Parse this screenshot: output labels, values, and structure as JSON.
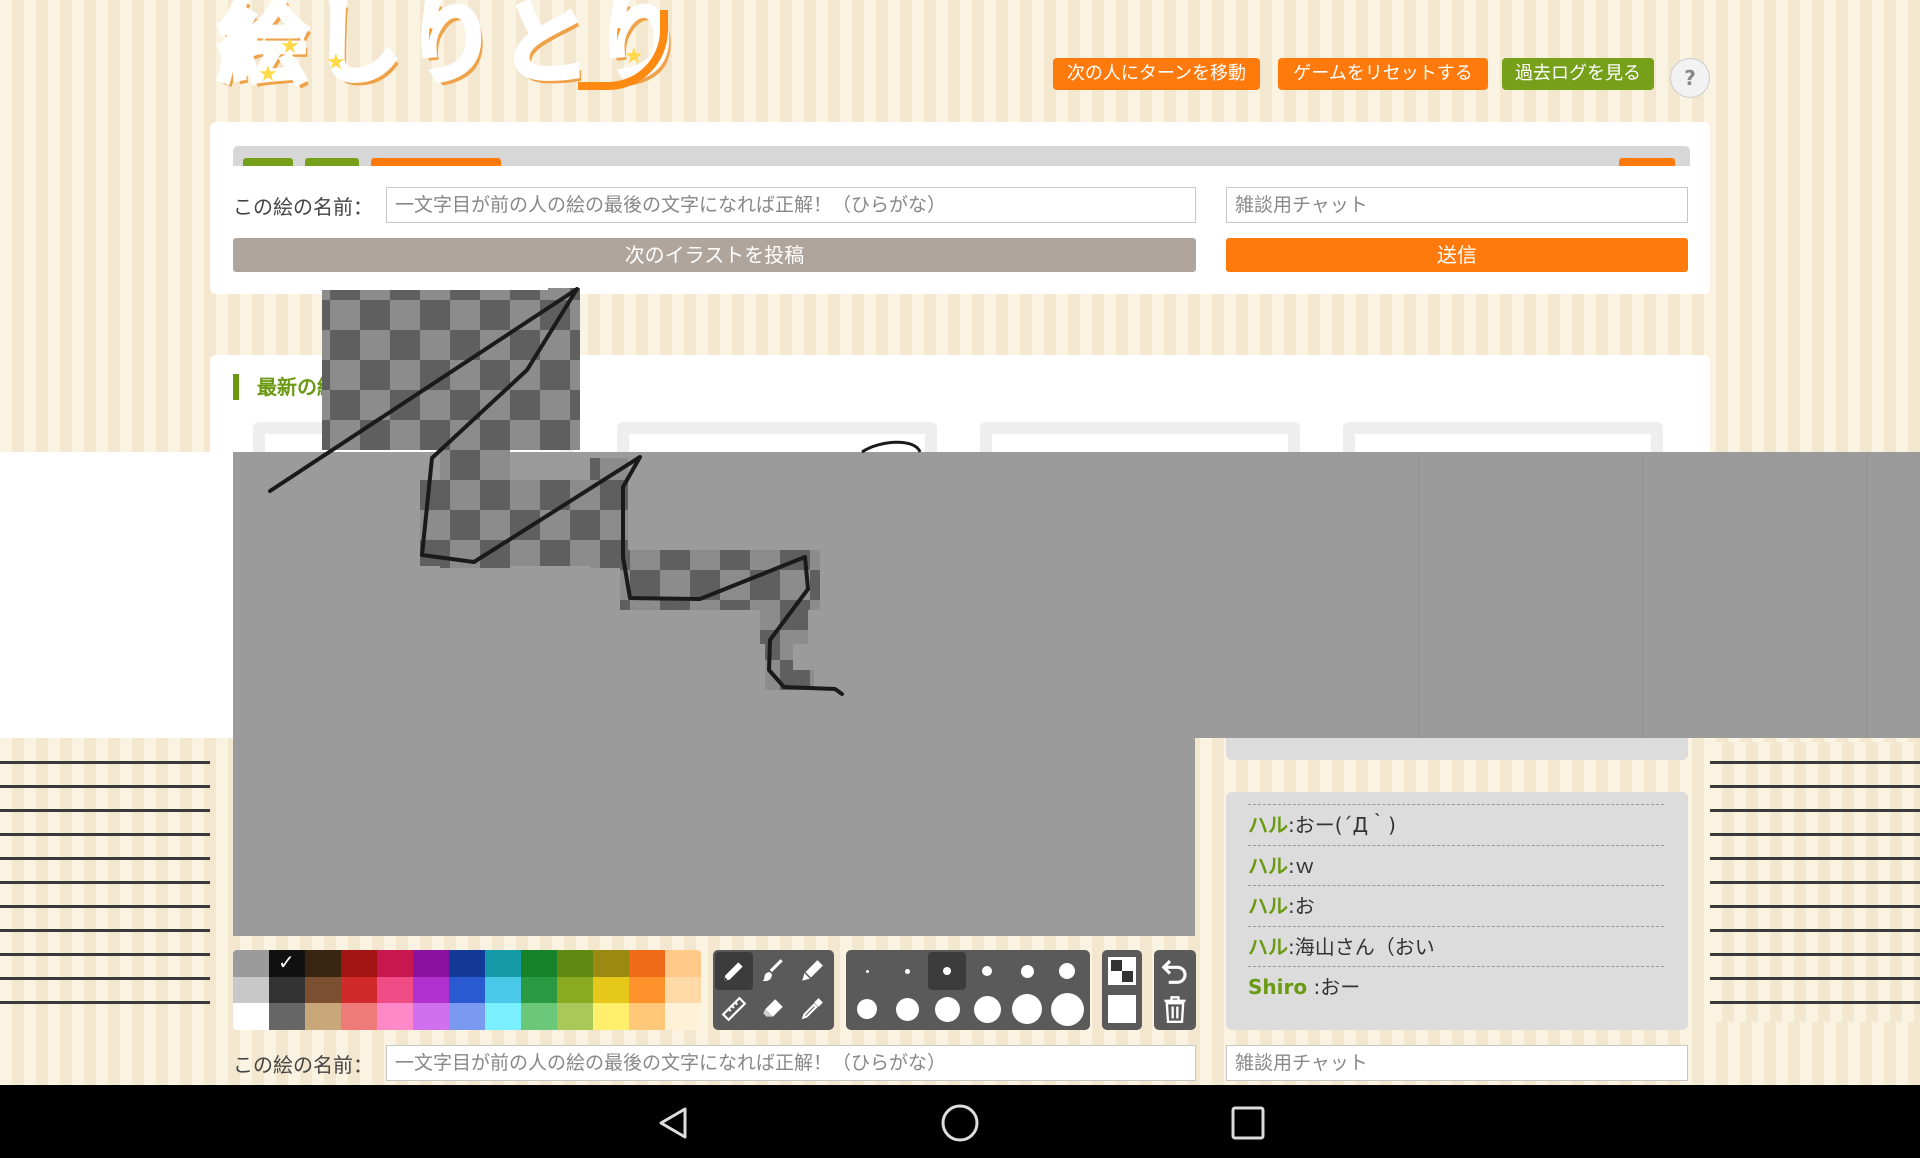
{
  "header": {
    "logo_text": "絵しりとり",
    "buttons": {
      "next_turn": "次の人にターンを移動",
      "reset": "ゲームをリセットする",
      "past_log": "過去ログを見る",
      "help": "?"
    }
  },
  "top_form": {
    "name_label": "この絵の名前：",
    "name_placeholder": "一文字目が前の人の絵の最後の文字になれば正解！（ひらがな）",
    "chat_placeholder": "雑談用チャット",
    "post_button": "次のイラストを投稿",
    "send_button": "送信"
  },
  "latest": {
    "heading": "最新の絵"
  },
  "colors": {
    "accent_orange": "#ff7a0d",
    "accent_green": "#76a01a",
    "post_button": "#b0a59c",
    "canvas": "#9b9b9b",
    "tool_box": "#5a5a5a",
    "palette": [
      "#9b9b9b",
      "#111111",
      "#3a2512",
      "#a31515",
      "#c8174e",
      "#8a12a0",
      "#133a96",
      "#159aa8",
      "#17822a",
      "#5e8a12",
      "#9a8a12",
      "#f06a18",
      "#ffc98a",
      "#c8c8c8",
      "#333333",
      "#7a5030",
      "#d02a2a",
      "#ef4c85",
      "#b030d0",
      "#2a5ad0",
      "#4ac8e8",
      "#2a9a42",
      "#8aaa22",
      "#e6c81a",
      "#ff922a",
      "#ffd9a6",
      "#ffffff",
      "#666666",
      "#c8a878",
      "#ef7a7a",
      "#ff88c8",
      "#d070ef",
      "#7a9aef",
      "#7aefff",
      "#6ac878",
      "#aac85a",
      "#ffef6a",
      "#ffc878",
      "#fff0d8"
    ]
  },
  "chat": {
    "messages": [
      {
        "name": "ハル",
        "sep": ":",
        "text": "おー(´Д｀)"
      },
      {
        "name": "ハル",
        "sep": ":",
        "text": "ｗ"
      },
      {
        "name": "ハル",
        "sep": ":",
        "text": "お"
      },
      {
        "name": "ハル",
        "sep": ":",
        "text": "海山さん（おい"
      },
      {
        "name": "Shiro",
        "sep": " :",
        "text": "おー"
      }
    ]
  },
  "bottom_form": {
    "name_label": "この絵の名前：",
    "name_placeholder": "一文字目が前の人の絵の最後の文字になれば正解！（ひらがな）",
    "chat_placeholder": "雑談用チャット"
  },
  "icons": {
    "pen": "pencil-icon",
    "brush": "brush-icon",
    "marker": "marker-icon",
    "ruler": "ruler-icon",
    "eraser": "eraser-icon",
    "eyedropper": "eyedropper-icon",
    "undo": "undo-icon",
    "trash": "trash-icon"
  }
}
